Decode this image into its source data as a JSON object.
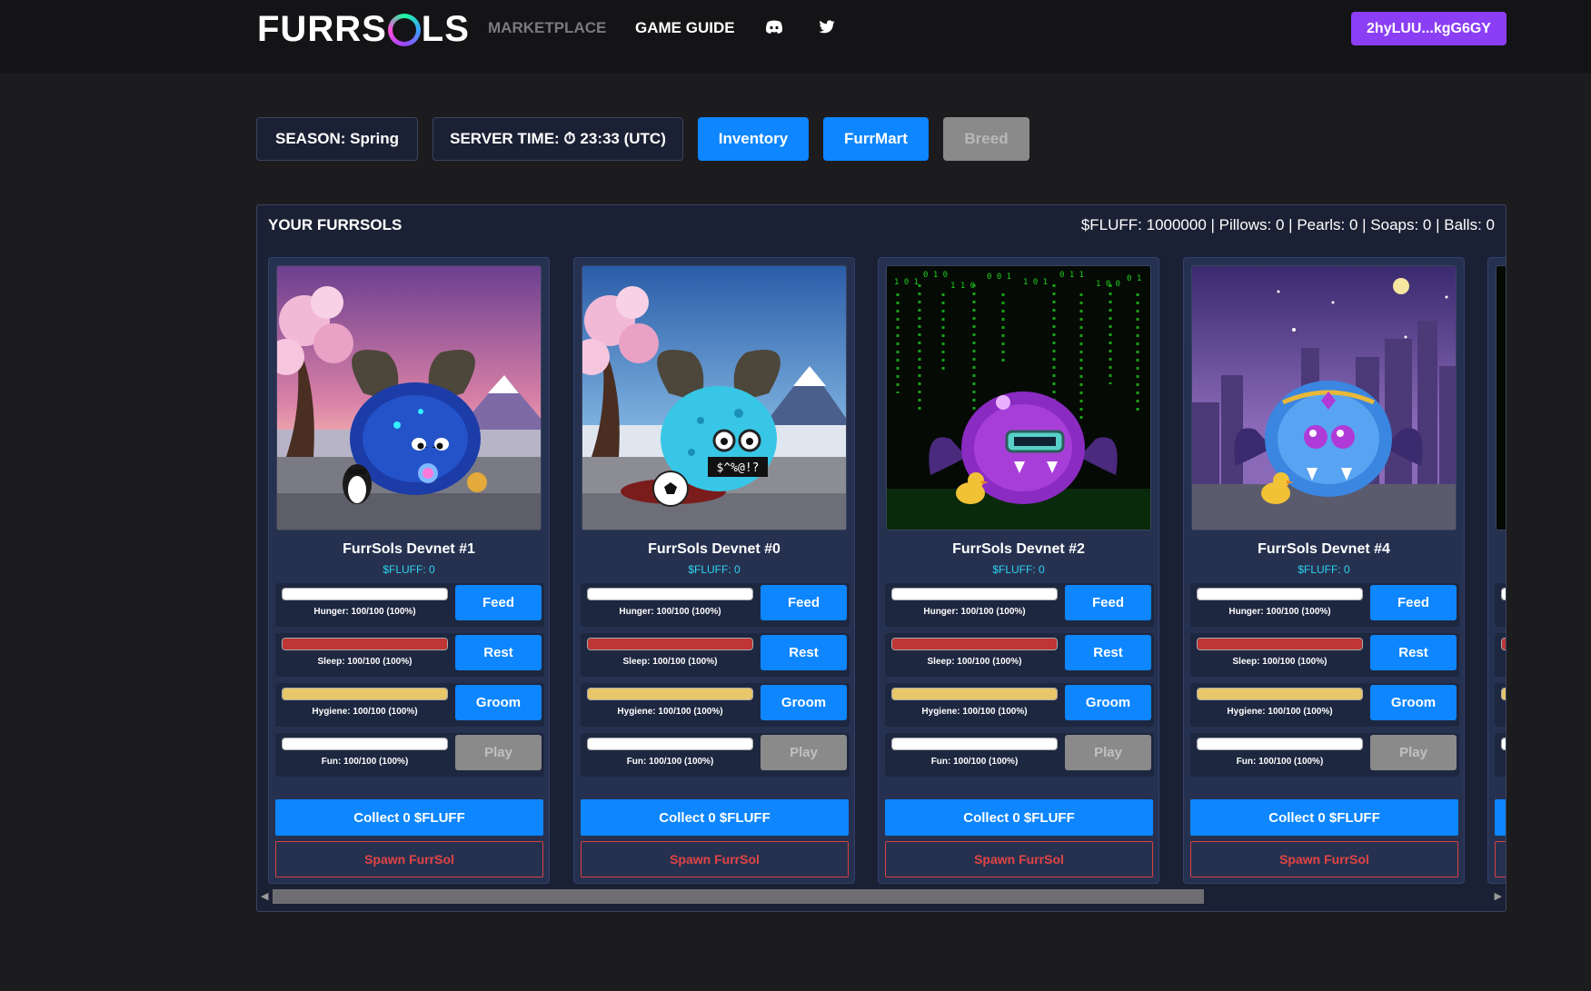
{
  "header": {
    "logo_left": "FURRS",
    "logo_right": "LS",
    "nav": {
      "marketplace": "MARKETPLACE",
      "game_guide": "GAME GUIDE"
    },
    "wallet": "2hyLUU...kgG6GY"
  },
  "controls": {
    "season": "SEASON: Spring",
    "server_time": "SERVER TIME: ⏱ 23:33 (UTC)",
    "inventory": "Inventory",
    "furrmart": "FurrMart",
    "breed": "Breed"
  },
  "panel": {
    "title": "YOUR FURRSOLS",
    "stats": "$FLUFF: 1000000 | Pillows: 0 | Pearls: 0 | Soaps: 0 | Balls: 0"
  },
  "cards": [
    {
      "name": "FurrSols Devnet #1",
      "fluff": "$FLUFF: 0",
      "hunger": "Hunger: 100/100 (100%)",
      "sleep": "Sleep: 100/100 (100%)",
      "hygiene": "Hygiene: 100/100 (100%)",
      "fun": "Fun: 100/100 (100%)",
      "feed": "Feed",
      "rest": "Rest",
      "groom": "Groom",
      "play": "Play",
      "collect": "Collect 0 $FLUFF",
      "spawn": "Spawn FurrSol"
    },
    {
      "name": "FurrSols Devnet #0",
      "fluff": "$FLUFF: 0",
      "hunger": "Hunger: 100/100 (100%)",
      "sleep": "Sleep: 100/100 (100%)",
      "hygiene": "Hygiene: 100/100 (100%)",
      "fun": "Fun: 100/100 (100%)",
      "feed": "Feed",
      "rest": "Rest",
      "groom": "Groom",
      "play": "Play",
      "collect": "Collect 0 $FLUFF",
      "spawn": "Spawn FurrSol",
      "sign_text": "$^%@!?"
    },
    {
      "name": "FurrSols Devnet #2",
      "fluff": "$FLUFF: 0",
      "hunger": "Hunger: 100/100 (100%)",
      "sleep": "Sleep: 100/100 (100%)",
      "hygiene": "Hygiene: 100/100 (100%)",
      "fun": "Fun: 100/100 (100%)",
      "feed": "Feed",
      "rest": "Rest",
      "groom": "Groom",
      "play": "Play",
      "collect": "Collect 0 $FLUFF",
      "spawn": "Spawn FurrSol"
    },
    {
      "name": "FurrSols Devnet #4",
      "fluff": "$FLUFF: 0",
      "hunger": "Hunger: 100/100 (100%)",
      "sleep": "Sleep: 100/100 (100%)",
      "hygiene": "Hygiene: 100/100 (100%)",
      "fun": "Fun: 100/100 (100%)",
      "feed": "Feed",
      "rest": "Rest",
      "groom": "Groom",
      "play": "Play",
      "collect": "Collect 0 $FLUFF",
      "spawn": "Spawn FurrSol"
    }
  ],
  "stat_levels": {
    "hunger": 1.0,
    "sleep": 1.0,
    "hygiene": 1.0,
    "fun": 1.0
  },
  "colors": {
    "accent_blue": "#0d86ff",
    "wallet_purple": "#8b3ff5",
    "hunger_bar": "#ffffff",
    "sleep_bar": "#c03535",
    "hygiene_bar": "#e8c76a",
    "fun_bar": "#ffffff",
    "spawn_red": "#e04444"
  }
}
